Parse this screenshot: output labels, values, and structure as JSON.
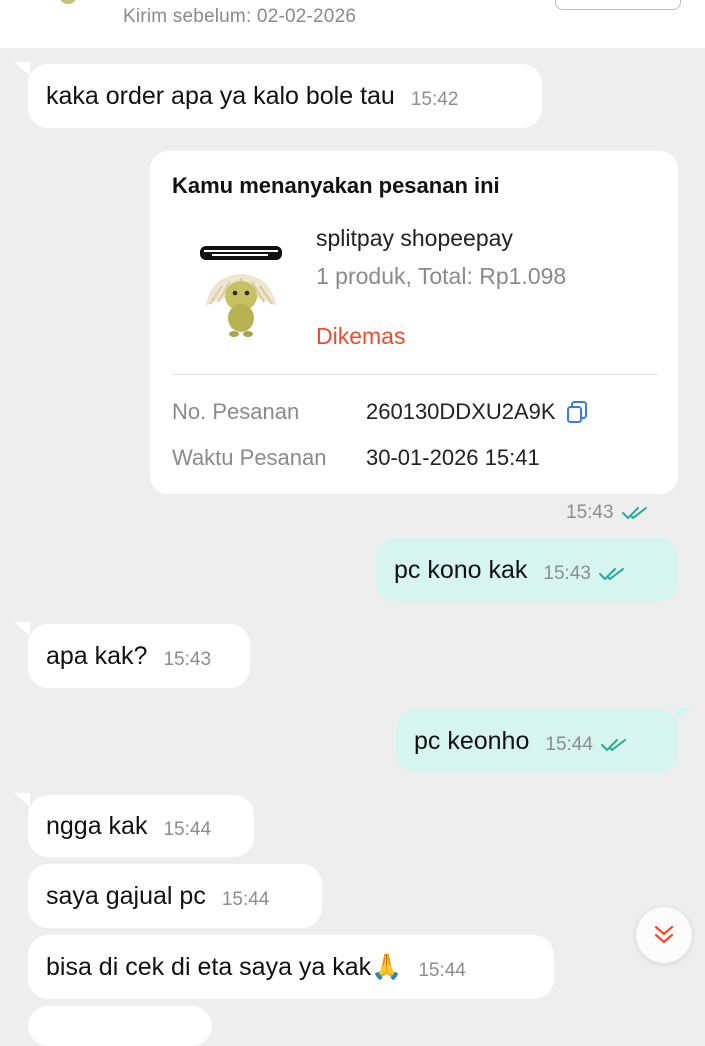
{
  "header": {
    "ship_before": "Kirim sebelum: 02-02-2026"
  },
  "order_card": {
    "title": "Kamu menanyakan pesanan ini",
    "product_name": "splitpay shopeepay",
    "product_info": "1 produk, Total: Rp1.098",
    "status": "Dikemas",
    "order_no_label": "No. Pesanan",
    "order_no": "260130DDXU2A9K",
    "order_time_label": "Waktu Pesanan",
    "order_time": "30-01-2026 15:41",
    "time": "15:43"
  },
  "messages": [
    {
      "direction": "in",
      "text": "kaka order apa ya kalo bole tau",
      "time": "15:42"
    },
    {
      "direction": "out",
      "text": "pc kono kak",
      "time": "15:43",
      "read": true
    },
    {
      "direction": "in",
      "text": "apa kak?",
      "time": "15:43"
    },
    {
      "direction": "out",
      "text": "pc keonho",
      "time": "15:44",
      "read": true
    },
    {
      "direction": "in",
      "text": "ngga kak",
      "time": "15:44"
    },
    {
      "direction": "in",
      "text": "saya gajual pc",
      "time": "15:44"
    },
    {
      "direction": "in",
      "text": "bisa di cek di eta saya ya kak🙏",
      "time": "15:44"
    }
  ],
  "colors": {
    "background": "#eeeeee",
    "incoming_bubble": "#ffffff",
    "outgoing_bubble": "#d6f5ef",
    "status_accent": "#ee4d2d",
    "read_tick": "#26aa99",
    "copy_icon": "#3b7ddd"
  },
  "icons": {
    "read_receipt": "double-check-icon",
    "copy": "copy-icon",
    "scroll_down": "chevron-double-down-icon"
  }
}
